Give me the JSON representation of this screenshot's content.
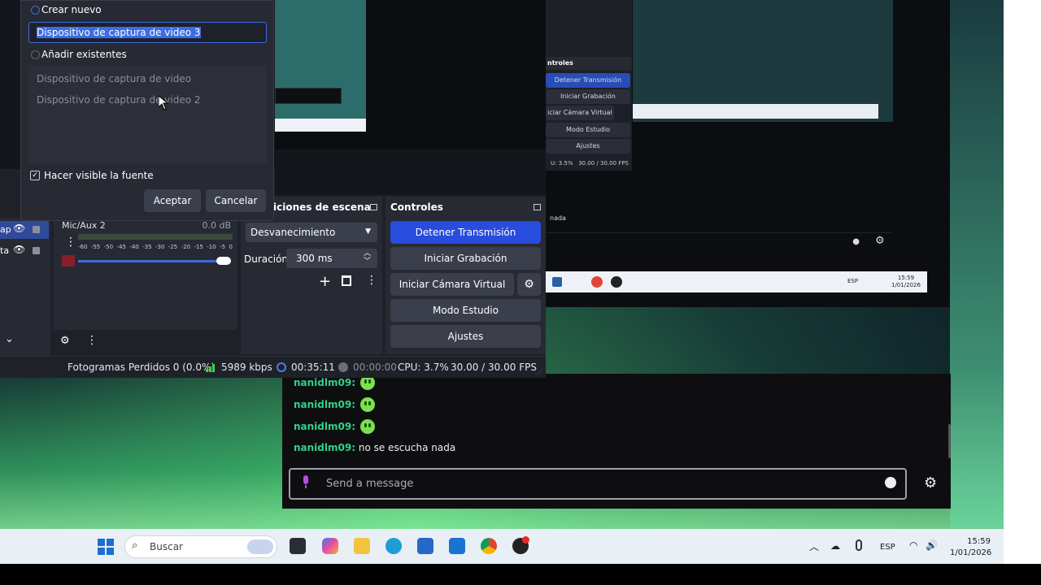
{
  "dialog": {
    "create_new_label": "Crear nuevo",
    "name_value": "Dispositivo de captura de video 3",
    "add_existing_label": "Añadir existentes",
    "existing_sources": [
      "Dispositivo de captura de video",
      "Dispositivo de captura de video 2"
    ],
    "make_visible_label": "Hacer visible la fuente",
    "accept_label": "Aceptar",
    "cancel_label": "Cancelar"
  },
  "sources": {
    "items": [
      "ap",
      "ta"
    ]
  },
  "audio_mixer": {
    "channel_name": "Mic/Aux 2",
    "level": "0.0 dB",
    "scale": [
      "-60",
      "-55",
      "-50",
      "-45",
      "-40",
      "-35",
      "-30",
      "-25",
      "-20",
      "-15",
      "-10",
      "-5",
      "0"
    ],
    "volume": 1.0
  },
  "transitions": {
    "header": "iciones de escena",
    "selected": "Desvanecimiento",
    "duration_label": "Duración",
    "duration_value": "300 ms"
  },
  "controls": {
    "header": "Controles",
    "stop_stream": "Detener Transmisión",
    "start_recording": "Iniciar Grabación",
    "start_virtual_cam": "Iniciar Cámara Virtual",
    "studio_mode": "Modo Estudio",
    "settings": "Ajustes"
  },
  "status_bar": {
    "dropped_frames": "Fotogramas Perdidos 0 (0.0%)",
    "bitrate": "5989 kbps",
    "stream_time": "00:35:11",
    "record_time": "00:00:00",
    "cpu": "CPU: 3.7%",
    "fps": "30.00 / 30.00 FPS"
  },
  "preview": {
    "header": "ntroles",
    "buttons": [
      "Detener Transmisión",
      "Iniciar Grabación",
      "iciar Cámara Virtual",
      "Modo Estudio",
      "Ajustes"
    ],
    "status": "U: 3.5%",
    "fps": "30.00 / 30.00 FPS",
    "chat_snippet": "nada",
    "lang": "ESP",
    "time": "15:59",
    "date": "1/01/2026"
  },
  "chat": {
    "messages": [
      {
        "user": "nanidlm09",
        "text": "",
        "emote": true
      },
      {
        "user": "nanidlm09",
        "text": "",
        "emote": true
      },
      {
        "user": "nanidlm09",
        "text": "",
        "emote": true
      },
      {
        "user": "nanidlm09",
        "text": "no se escucha nada",
        "emote": false
      }
    ],
    "separator": ":",
    "placeholder": "Send a message"
  },
  "taskbar": {
    "search_placeholder": "Buscar",
    "lang": "ESP",
    "time": "15:59",
    "date": "1/01/2026"
  },
  "colors": {
    "accent_blue": "#284cdd",
    "obs_bg": "#1f2129",
    "chat_user": "#2fd28a"
  }
}
